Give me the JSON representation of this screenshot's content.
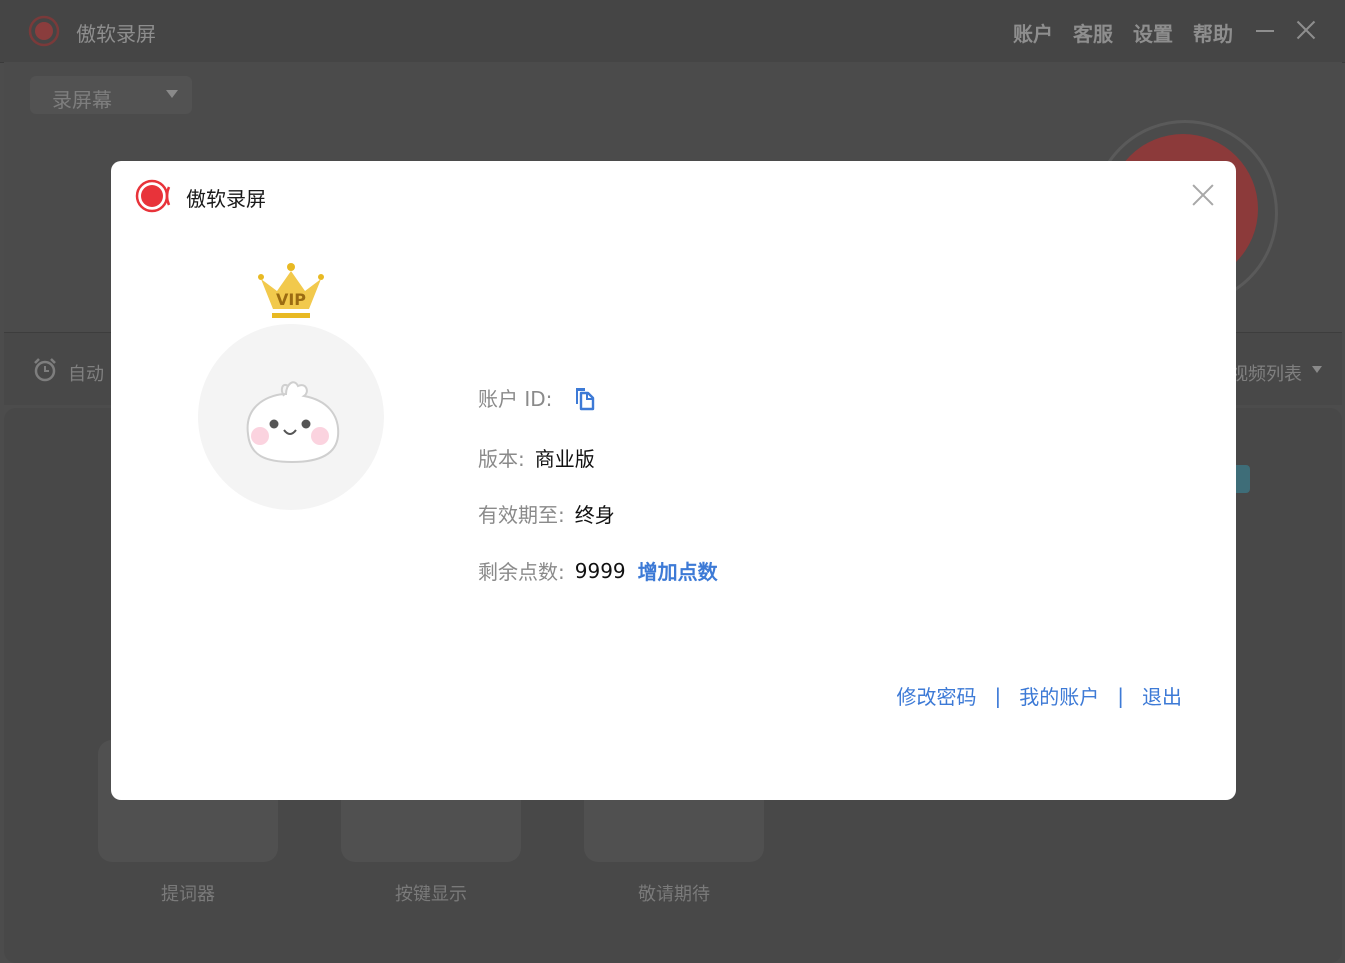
{
  "app": {
    "title": "傲软录屏",
    "nav": [
      "账户",
      "客服",
      "设置",
      "帮助"
    ],
    "mode_select": "录屏幕",
    "auto_label": "自动",
    "video_list_label": "视频列表",
    "tools": [
      "提词器",
      "按键显示",
      "敬请期待"
    ]
  },
  "modal": {
    "title": "傲软录屏",
    "vip_badge": "VIP",
    "account_id_label": "账户 ID:",
    "version_label": "版本:",
    "version_value": "商业版",
    "expiry_label": "有效期至:",
    "expiry_value": "终身",
    "points_label": "剩余点数:",
    "points_value": "9999",
    "add_points": "增加点数",
    "links": {
      "change_password": "修改密码",
      "my_account": "我的账户",
      "logout": "退出",
      "separator": "|"
    }
  },
  "colors": {
    "accent": "#3d7ad6",
    "brand_red": "#e8333a",
    "crown_gold": "#e8b923"
  }
}
